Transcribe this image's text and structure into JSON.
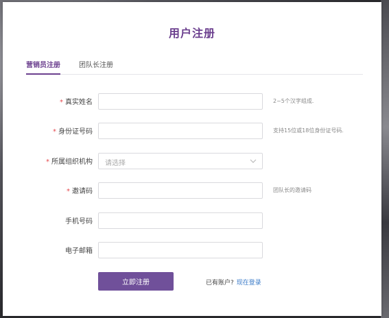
{
  "page": {
    "title": "用户注册"
  },
  "tabs": [
    {
      "label": "营销员注册",
      "active": true
    },
    {
      "label": "团队长注册",
      "active": false
    }
  ],
  "form": {
    "real_name": {
      "label": "真实姓名",
      "required": true,
      "value": "",
      "hint": "2~5个汉字组成."
    },
    "id_number": {
      "label": "身份证号码",
      "required": true,
      "value": "",
      "hint": "支持15位或18位身份证号码."
    },
    "organization": {
      "label": "所属组织机构",
      "required": true,
      "placeholder": "请选择"
    },
    "invite_code": {
      "label": "邀请码",
      "required": true,
      "value": "",
      "hint": "团队长的邀请码"
    },
    "phone": {
      "label": "手机号码",
      "required": false,
      "value": ""
    },
    "email": {
      "label": "电子邮箱",
      "required": false,
      "value": ""
    },
    "required_mark": "*"
  },
  "actions": {
    "submit_label": "立即注册",
    "have_account": "已有账户?",
    "login_label": "现在登录"
  },
  "colors": {
    "accent": "#6b3f8e",
    "button": "#70509a",
    "link": "#3b7bc8",
    "required": "#e5484d"
  },
  "icons": {
    "select_arrow": "chevron-down-icon"
  }
}
